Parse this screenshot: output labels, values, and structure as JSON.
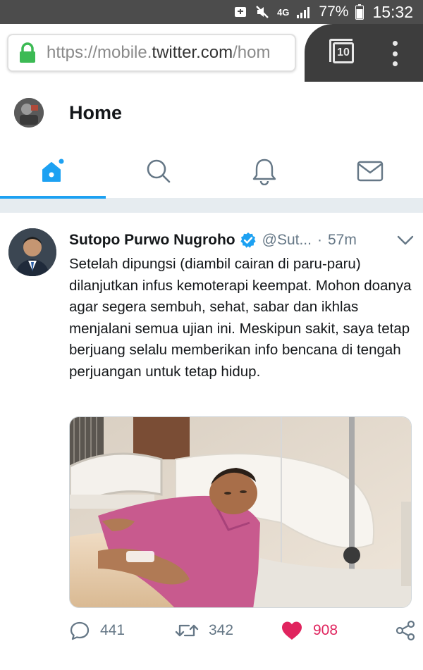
{
  "status_bar": {
    "network": "4G",
    "battery_percent": "77%",
    "time": "15:32"
  },
  "browser": {
    "url_scheme": "https://mobile.",
    "url_host": "twitter.com",
    "url_rest": "/hom",
    "tab_count": "10"
  },
  "header": {
    "title": "Home"
  },
  "tabs": [
    {
      "name": "home",
      "active": true
    },
    {
      "name": "search",
      "active": false
    },
    {
      "name": "notifications",
      "active": false
    },
    {
      "name": "messages",
      "active": false
    }
  ],
  "tweet": {
    "author": "Sutopo Purwo Nugroho",
    "handle": "@Sut...",
    "separator": "·",
    "time": "57m",
    "text": "Setelah dipungsi (diambil cairan di paru-paru) dilanjutkan infus kemoterapi keempat. Mohon doanya agar segera sembuh, sehat, sabar dan ikhlas menjalani semua ujian ini. Meskipun sakit, saya tetap berjuang selalu memberikan info bencana di tengah perjuangan untuk tetap hidup.",
    "replies": "441",
    "retweets": "342",
    "likes": "908"
  },
  "colors": {
    "accent": "#1da1f2",
    "like": "#e0245e",
    "muted": "#657786",
    "status_bar": "#4c4c4c"
  }
}
